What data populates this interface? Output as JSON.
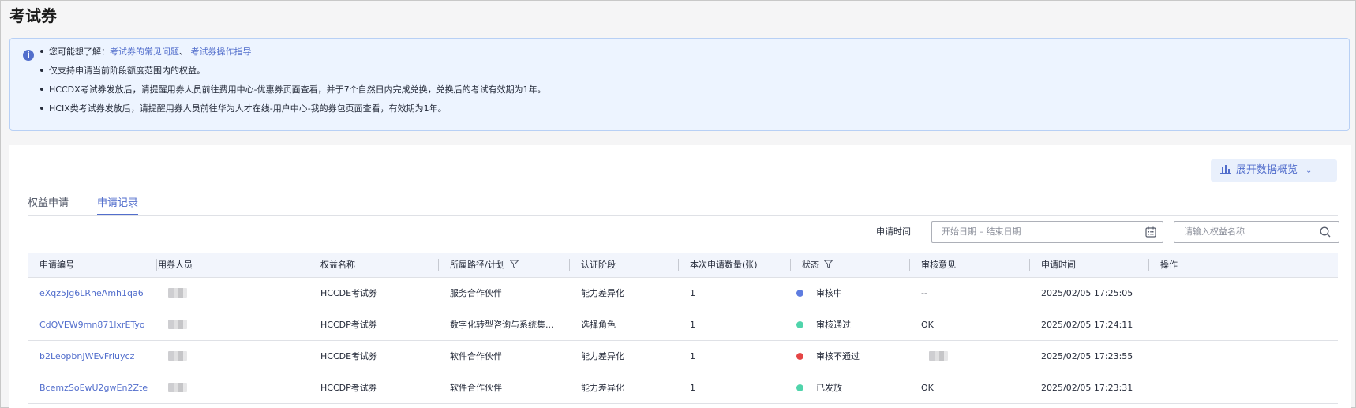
{
  "page": {
    "title": "考试券"
  },
  "notice": {
    "intro": "您可能想了解：",
    "link1": "考试券的常见问题",
    "separator": "、",
    "link2": "考试券操作指导",
    "lines": [
      "仅支持申请当前阶段额度范围内的权益。",
      "HCCDX考试券发放后，请提醒用券人员前往费用中心-优惠券页面查看，并于7个自然日内完成兑换，兑换后的考试有效期为1年。",
      "HCIX类考试券发放后，请提醒用券人员前往华为人才在线-用户中心-我的券包页面查看，有效期为1年。"
    ]
  },
  "toolbar": {
    "overview_label": "展开数据概览"
  },
  "tabs": [
    {
      "label": "权益申请",
      "active": false
    },
    {
      "label": "申请记录",
      "active": true
    }
  ],
  "filters": {
    "date_label": "申请时间",
    "date_placeholder": "开始日期 – 结束日期",
    "search_placeholder": "请输入权益名称"
  },
  "table": {
    "columns": [
      "申请编号",
      "用券人员",
      "权益名称",
      "所属路径/计划",
      "认证阶段",
      "本次申请数量(张)",
      "状态",
      "审核意见",
      "申请时间",
      "操作"
    ],
    "rows": [
      {
        "id": "eXqz5Jg6LRneAmh1qa6",
        "user": "",
        "name": "HCCDE考试券",
        "path": "服务合作伙伴",
        "stage": "能力差异化",
        "qty": "1",
        "status": "审核中",
        "status_color": "#5e7ce0",
        "opinion": "--",
        "opinion_blurred": false,
        "time": "2025/02/05 17:25:05"
      },
      {
        "id": "CdQVEW9mn871lxrETyo",
        "user": "",
        "name": "HCCDP考试券",
        "path": "数字化转型咨询与系统集...",
        "stage": "选择角色",
        "qty": "1",
        "status": "审核通过",
        "status_color": "#50d4ab",
        "opinion": "OK",
        "opinion_blurred": false,
        "time": "2025/02/05 17:24:11"
      },
      {
        "id": "b2LeopbnJWEvFrluycz",
        "user": "",
        "name": "HCCDE考试券",
        "path": "软件合作伙伴",
        "stage": "能力差异化",
        "qty": "1",
        "status": "审核不通过",
        "status_color": "#e54545",
        "opinion": "",
        "opinion_blurred": true,
        "time": "2025/02/05 17:23:55"
      },
      {
        "id": "BcemzSoEwU2gwEn2Zte",
        "user": "",
        "name": "HCCDP考试券",
        "path": "软件合作伙伴",
        "stage": "能力差异化",
        "qty": "1",
        "status": "已发放",
        "status_color": "#50d4ab",
        "opinion": "OK",
        "opinion_blurred": false,
        "time": "2025/02/05 17:23:31"
      }
    ]
  }
}
